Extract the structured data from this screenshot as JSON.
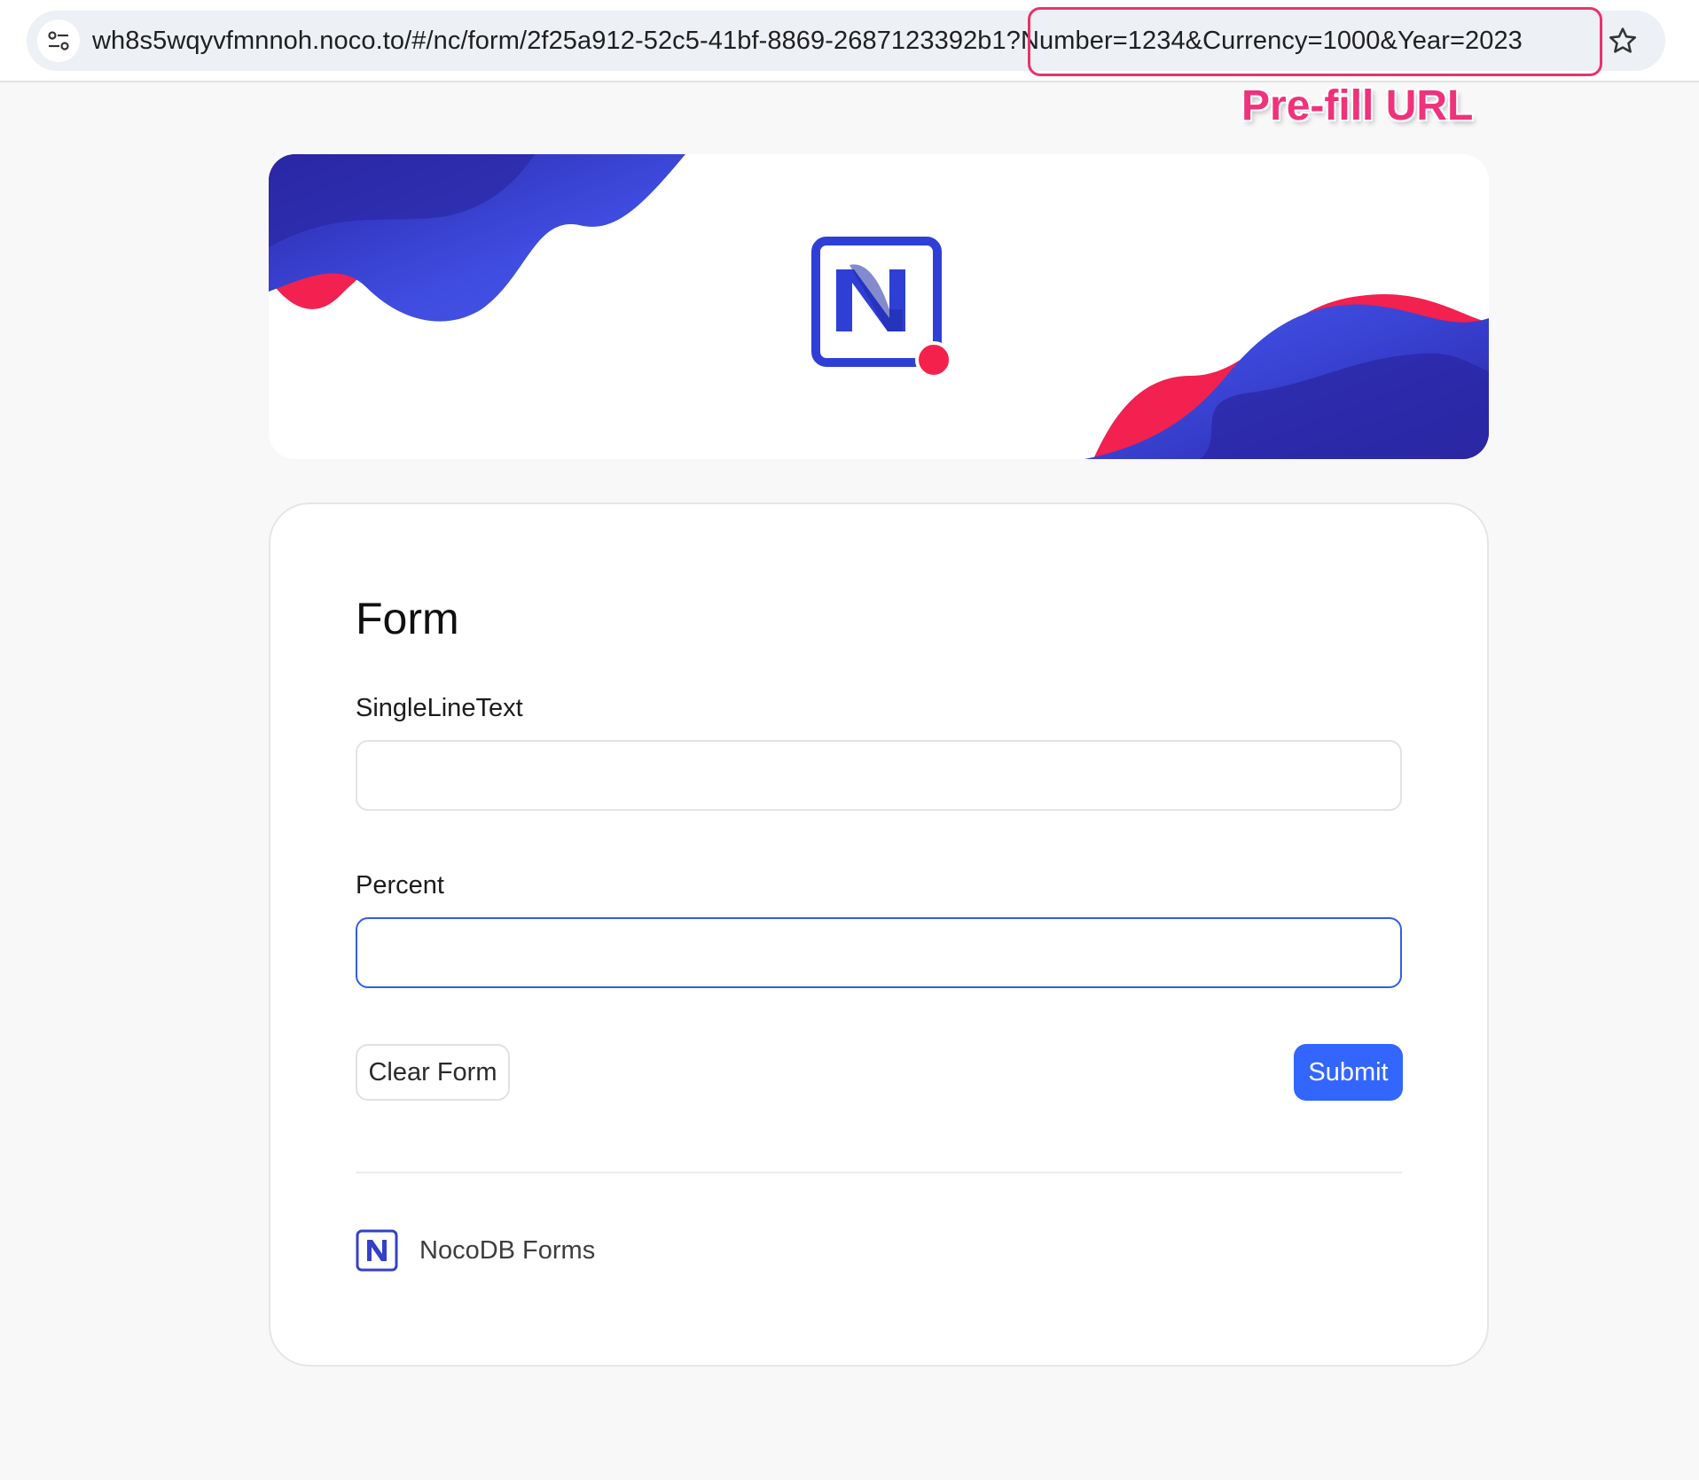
{
  "browser": {
    "url": "wh8s5wqyvfmnnoh.noco.to/#/nc/form/2f25a912-52c5-41bf-8869-2687123392b1?Number=1234&Currency=1000&Year=2023",
    "site_info_icon": "tune-icon",
    "bookmark_icon": "star-icon"
  },
  "annotation": {
    "label": "Pre-fill URL",
    "color": "#f0327b"
  },
  "banner": {
    "logo": "nocodb-logo",
    "brand_blue": "#3a47d9",
    "brand_red": "#f5214d"
  },
  "form": {
    "title": "Form",
    "fields": [
      {
        "label": "SingleLineText",
        "value": "",
        "focused": false
      },
      {
        "label": "Percent",
        "value": "",
        "focused": true
      }
    ],
    "clear_label": "Clear Form",
    "submit_label": "Submit",
    "submit_color": "#3366ff"
  },
  "footer": {
    "brand_text": "NocoDB Forms"
  }
}
